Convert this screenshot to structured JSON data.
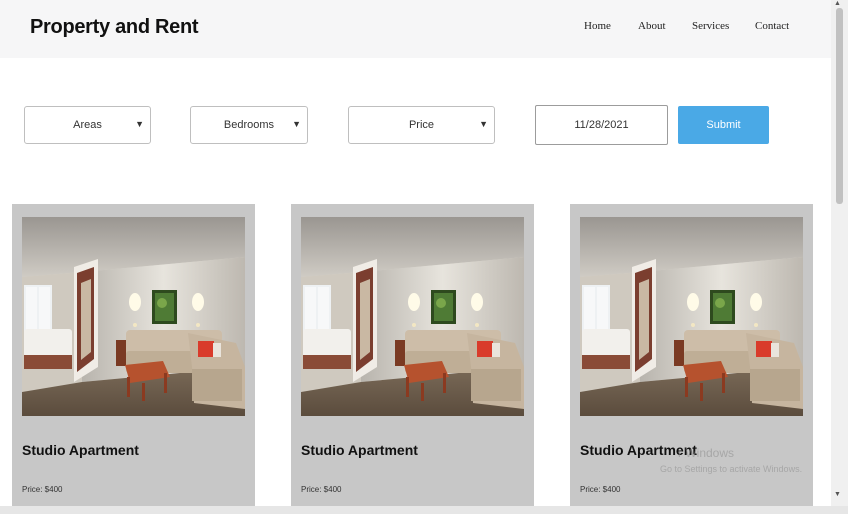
{
  "navbar": {
    "brand": "Property and Rent",
    "links": [
      {
        "label": "Home"
      },
      {
        "label": "About"
      },
      {
        "label": "Services"
      },
      {
        "label": "Contact"
      }
    ]
  },
  "filters": {
    "areas": {
      "selected": "Areas"
    },
    "bedrooms": {
      "selected": "Bedrooms"
    },
    "price": {
      "selected": "Price"
    },
    "date": {
      "value": "11/28/2021"
    },
    "submit_label": "Submit"
  },
  "listings": [
    {
      "title": "Studio Apartment",
      "price": "Price: $400"
    },
    {
      "title": "Studio Apartment",
      "price": "Price: $400"
    },
    {
      "title": "Studio Apartment",
      "price": "Price: $400"
    }
  ],
  "watermark": {
    "line1": "r Windows",
    "line2": "Go to Settings to activate Windows."
  },
  "colors": {
    "accent": "#4aa9e6",
    "card_bg": "#c7c7c7",
    "navbar_bg": "#f6f6f7"
  }
}
